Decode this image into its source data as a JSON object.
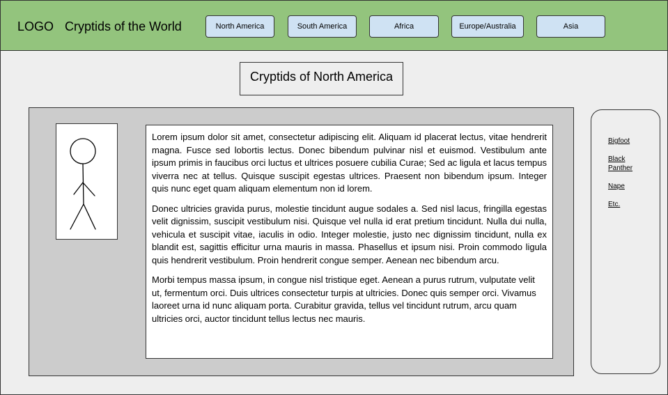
{
  "header": {
    "logo": "LOGO",
    "site_title": "Cryptids of the World",
    "nav": [
      {
        "label": "North America"
      },
      {
        "label": "South America"
      },
      {
        "label": "Africa"
      },
      {
        "label": "Europe/Australia"
      },
      {
        "label": "Asia"
      }
    ]
  },
  "main": {
    "page_title": "Cryptids of North America",
    "figure_icon": "stick-figure-icon",
    "paragraphs": [
      "Lorem ipsum dolor sit amet, consectetur adipiscing elit. Aliquam id placerat lectus, vitae hendrerit magna. Fusce sed lobortis lectus. Donec bibendum pulvinar nisl et euismod. Vestibulum ante ipsum primis in faucibus orci luctus et ultrices posuere cubilia Curae; Sed ac ligula et lacus tempus viverra nec at tellus. Quisque suscipit egestas ultrices. Praesent non bibendum ipsum. Integer quis nunc eget quam aliquam elementum non id lorem.",
      "Donec ultricies gravida purus, molestie tincidunt augue sodales a. Sed nisl lacus, fringilla egestas velit dignissim, suscipit vestibulum nisi. Quisque vel nulla id erat pretium tincidunt. Nulla dui nulla, vehicula et suscipit vitae, iaculis in odio. Integer molestie, justo nec dignissim tincidunt, nulla ex blandit est, sagittis efficitur urna mauris in massa. Phasellus et ipsum nisi. Proin commodo ligula quis hendrerit vestibulum. Proin hendrerit congue semper. Aenean nec bibendum arcu.",
      "Morbi tempus massa ipsum, in congue nisl tristique eget. Aenean a purus rutrum, vulputate velit ut, fermentum orci. Duis ultrices consectetur turpis at ultricies. Donec quis semper orci. Vivamus laoreet urna id nunc aliquam porta. Curabitur gravida, tellus vel tincidunt rutrum, arcu quam ultricies orci, auctor tincidunt tellus lectus nec mauris."
    ]
  },
  "sidebar": {
    "links": [
      {
        "label": "Bigfoot"
      },
      {
        "label": "Black Panther"
      },
      {
        "label": "Nape"
      },
      {
        "label": "Etc."
      }
    ]
  },
  "colors": {
    "header_bg": "#93c47d",
    "nav_button_bg": "#cfe2f3",
    "page_bg": "#eeeeee",
    "content_panel_bg": "#cccccc"
  }
}
